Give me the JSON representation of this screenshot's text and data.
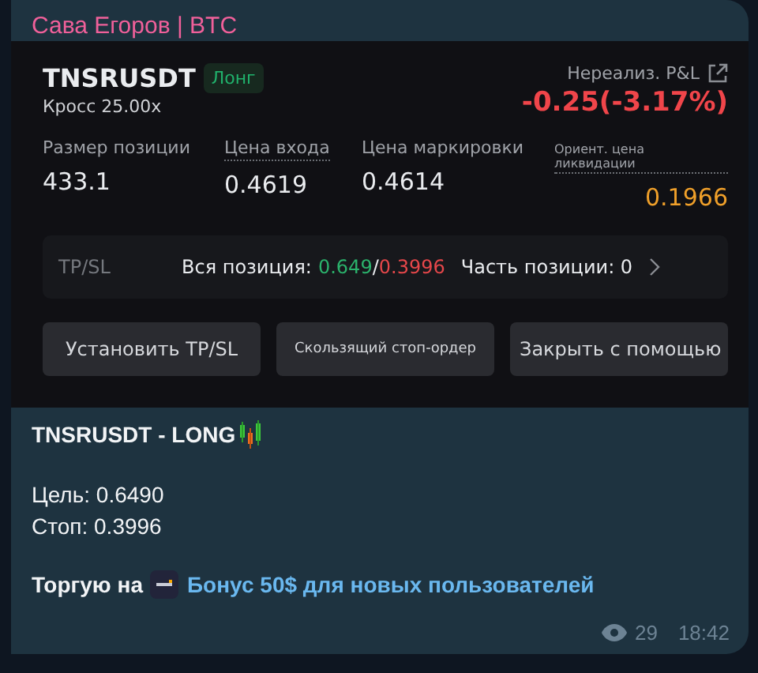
{
  "message": {
    "sender": "Сава Егоров | BTC",
    "screenshot": {
      "symbol": "TNSRUSDT",
      "side": "Лонг",
      "margin": "Кросс 25.00x",
      "pnl_label": "Нереализ. P&L",
      "pnl_value": "-0.25(-3.17%)",
      "stats": [
        {
          "label": "Размер позиции",
          "value": "433.1",
          "kind": "plain",
          "underlined": false
        },
        {
          "label": "Цена входа",
          "value": "0.4619",
          "kind": "plain",
          "underlined": true
        },
        {
          "label": "Цена маркировки",
          "value": "0.4614",
          "kind": "plain",
          "underlined": false
        },
        {
          "label": "Ориент. цена ликвидации",
          "value": "0.1966",
          "kind": "liquidation",
          "underlined": true
        }
      ],
      "tpsl": {
        "label": "TP/SL",
        "whole_label": "Вся позиция:",
        "tp": "0.649",
        "separator": "/",
        "sl": "0.3996",
        "part": "Часть позиции: 0"
      },
      "buttons": [
        "Установить TP/SL",
        "Скользящий стоп-ордер",
        "Закрыть с помощью"
      ]
    },
    "title": "TNSRUSDT - LONG",
    "lines": [
      "Цель: 0.6490",
      "Стоп: 0.3996"
    ],
    "promo_prefix": "Торгую на",
    "promo_link": "Бонус 50$ для новых пользователей",
    "views": "29",
    "time": "18:42"
  }
}
